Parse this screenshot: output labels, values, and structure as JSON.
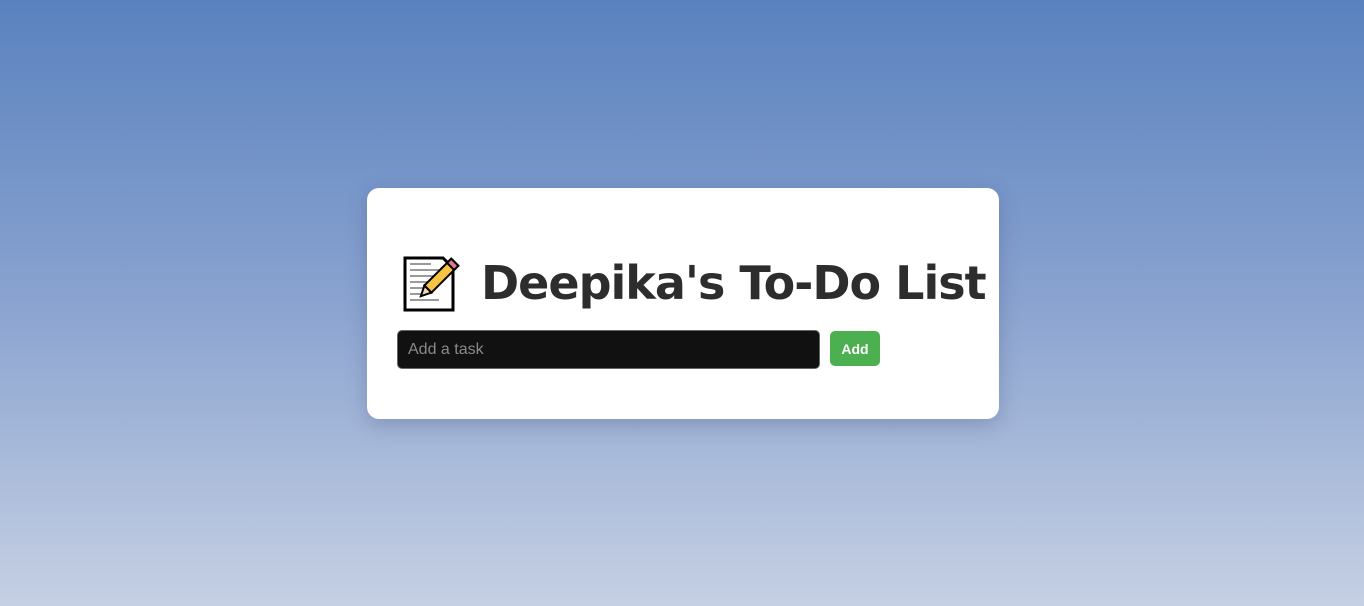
{
  "header": {
    "title": "Deepika's To-Do List",
    "icon": "memo-icon"
  },
  "task_form": {
    "placeholder": "Add a task",
    "value": "",
    "add_label": "Add"
  },
  "colors": {
    "background_top": "#5a82bf",
    "background_bottom": "#c5d0e3",
    "card": "#ffffff",
    "input_bg": "#111111",
    "add_button": "#4caf50"
  }
}
